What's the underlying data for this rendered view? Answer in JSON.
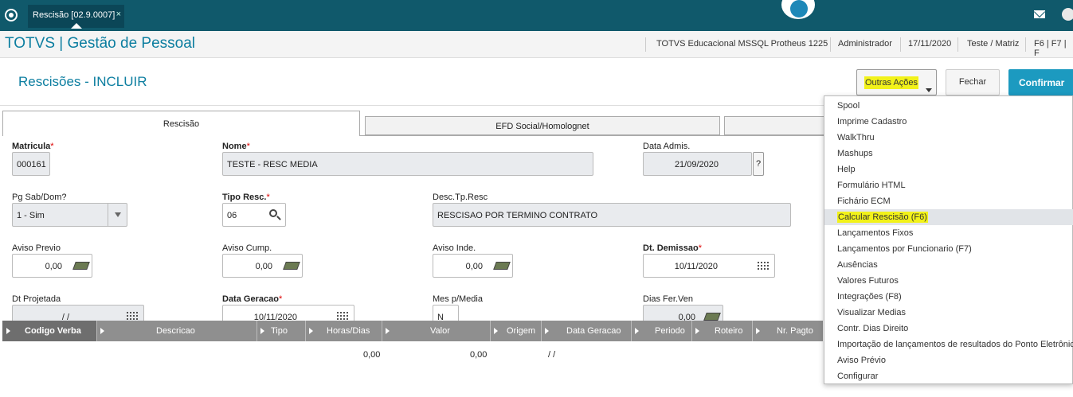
{
  "topbar": {
    "tab_label": "Rescisão [02.9.0007]",
    "tab_close": "×"
  },
  "header": {
    "app_title": "TOTVS | Gestão de Pessoal",
    "environment": "TOTVS Educacional MSSQL Protheus 1225",
    "user": "Administrador",
    "date": "17/11/2020",
    "company": "Teste / Matriz",
    "shortcuts": "F6 | F7 | F"
  },
  "page": {
    "title": "Rescisões - INCLUIR",
    "outras_acoes": "Outras Ações",
    "fechar": "Fechar",
    "confirmar": "Confirmar"
  },
  "tabs": [
    "Rescisão",
    "EFD Social/Homolognet"
  ],
  "form": {
    "matricula": {
      "label": "Matricula",
      "value": "000161"
    },
    "nome": {
      "label": "Nome",
      "value": "TESTE - RESC MEDIA"
    },
    "data_admis": {
      "label": "Data Admis.",
      "value": "21/09/2020",
      "help": "?"
    },
    "pg_sab_dom": {
      "label": "Pg Sab/Dom?",
      "value": "1 - Sim"
    },
    "tipo_resc": {
      "label": "Tipo Resc.",
      "value": "06"
    },
    "desc_tp_resc": {
      "label": "Desc.Tp.Resc",
      "value": "RESCISAO POR TERMINO CONTRATO"
    },
    "aviso_previo": {
      "label": "Aviso Previo",
      "value": "0,00"
    },
    "aviso_cump": {
      "label": "Aviso Cump.",
      "value": "0,00"
    },
    "aviso_inde": {
      "label": "Aviso Inde.",
      "value": "0,00"
    },
    "dt_demissao": {
      "label": "Dt. Demissao",
      "value": "10/11/2020"
    },
    "dt_projetada": {
      "label": "Dt Projetada",
      "value": "/ /"
    },
    "data_geracao": {
      "label": "Data Geracao",
      "value": "10/11/2020"
    },
    "mes_p_media": {
      "label": "Mes p/Media",
      "value": "N"
    },
    "dias_fer_ven": {
      "label": "Dias Fer.Ven",
      "value": "0,00"
    },
    "required_mark": "*"
  },
  "grid": {
    "columns": [
      "Codigo Verba",
      "Descricao",
      "Tipo",
      "Horas/Dias",
      "Valor",
      "Origem",
      "Data Geracao",
      "Periodo",
      "Roteiro",
      "Nr. Pagto"
    ],
    "row": {
      "horas": "0,00",
      "valor": "0,00",
      "data_geracao": "/ /"
    }
  },
  "menu": {
    "items": [
      "Spool",
      "Imprime Cadastro",
      "WalkThru",
      "Mashups",
      "Help",
      "Formulário HTML",
      "Fichário ECM",
      "Calcular Rescisão (F6)",
      "Lançamentos Fixos",
      "Lançamentos por Funcionario (F7)",
      "Ausências",
      "Valores Futuros",
      "Integrações (F8)",
      "Visualizar Medias",
      "Contr. Dias Direito",
      "Importação de lançamentos de resultados do Ponto Eletrônico",
      "Aviso Prévio",
      "Configurar"
    ],
    "highlighted_index": 7
  },
  "colors": {
    "topbar": "#10596b",
    "accent": "#0c7ea0",
    "confirm": "#1c9ac0",
    "highlight": "#f2f21a"
  }
}
